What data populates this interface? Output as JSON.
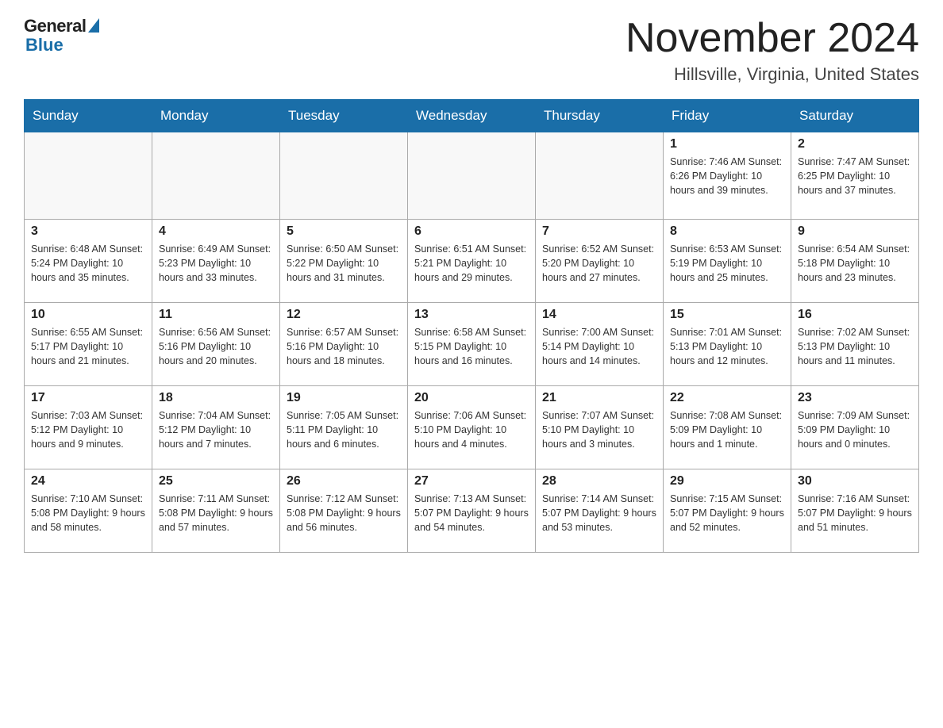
{
  "logo": {
    "general": "General",
    "blue": "Blue"
  },
  "header": {
    "month": "November 2024",
    "location": "Hillsville, Virginia, United States"
  },
  "weekdays": [
    "Sunday",
    "Monday",
    "Tuesday",
    "Wednesday",
    "Thursday",
    "Friday",
    "Saturday"
  ],
  "weeks": [
    [
      {
        "day": "",
        "info": ""
      },
      {
        "day": "",
        "info": ""
      },
      {
        "day": "",
        "info": ""
      },
      {
        "day": "",
        "info": ""
      },
      {
        "day": "",
        "info": ""
      },
      {
        "day": "1",
        "info": "Sunrise: 7:46 AM\nSunset: 6:26 PM\nDaylight: 10 hours and 39 minutes."
      },
      {
        "day": "2",
        "info": "Sunrise: 7:47 AM\nSunset: 6:25 PM\nDaylight: 10 hours and 37 minutes."
      }
    ],
    [
      {
        "day": "3",
        "info": "Sunrise: 6:48 AM\nSunset: 5:24 PM\nDaylight: 10 hours and 35 minutes."
      },
      {
        "day": "4",
        "info": "Sunrise: 6:49 AM\nSunset: 5:23 PM\nDaylight: 10 hours and 33 minutes."
      },
      {
        "day": "5",
        "info": "Sunrise: 6:50 AM\nSunset: 5:22 PM\nDaylight: 10 hours and 31 minutes."
      },
      {
        "day": "6",
        "info": "Sunrise: 6:51 AM\nSunset: 5:21 PM\nDaylight: 10 hours and 29 minutes."
      },
      {
        "day": "7",
        "info": "Sunrise: 6:52 AM\nSunset: 5:20 PM\nDaylight: 10 hours and 27 minutes."
      },
      {
        "day": "8",
        "info": "Sunrise: 6:53 AM\nSunset: 5:19 PM\nDaylight: 10 hours and 25 minutes."
      },
      {
        "day": "9",
        "info": "Sunrise: 6:54 AM\nSunset: 5:18 PM\nDaylight: 10 hours and 23 minutes."
      }
    ],
    [
      {
        "day": "10",
        "info": "Sunrise: 6:55 AM\nSunset: 5:17 PM\nDaylight: 10 hours and 21 minutes."
      },
      {
        "day": "11",
        "info": "Sunrise: 6:56 AM\nSunset: 5:16 PM\nDaylight: 10 hours and 20 minutes."
      },
      {
        "day": "12",
        "info": "Sunrise: 6:57 AM\nSunset: 5:16 PM\nDaylight: 10 hours and 18 minutes."
      },
      {
        "day": "13",
        "info": "Sunrise: 6:58 AM\nSunset: 5:15 PM\nDaylight: 10 hours and 16 minutes."
      },
      {
        "day": "14",
        "info": "Sunrise: 7:00 AM\nSunset: 5:14 PM\nDaylight: 10 hours and 14 minutes."
      },
      {
        "day": "15",
        "info": "Sunrise: 7:01 AM\nSunset: 5:13 PM\nDaylight: 10 hours and 12 minutes."
      },
      {
        "day": "16",
        "info": "Sunrise: 7:02 AM\nSunset: 5:13 PM\nDaylight: 10 hours and 11 minutes."
      }
    ],
    [
      {
        "day": "17",
        "info": "Sunrise: 7:03 AM\nSunset: 5:12 PM\nDaylight: 10 hours and 9 minutes."
      },
      {
        "day": "18",
        "info": "Sunrise: 7:04 AM\nSunset: 5:12 PM\nDaylight: 10 hours and 7 minutes."
      },
      {
        "day": "19",
        "info": "Sunrise: 7:05 AM\nSunset: 5:11 PM\nDaylight: 10 hours and 6 minutes."
      },
      {
        "day": "20",
        "info": "Sunrise: 7:06 AM\nSunset: 5:10 PM\nDaylight: 10 hours and 4 minutes."
      },
      {
        "day": "21",
        "info": "Sunrise: 7:07 AM\nSunset: 5:10 PM\nDaylight: 10 hours and 3 minutes."
      },
      {
        "day": "22",
        "info": "Sunrise: 7:08 AM\nSunset: 5:09 PM\nDaylight: 10 hours and 1 minute."
      },
      {
        "day": "23",
        "info": "Sunrise: 7:09 AM\nSunset: 5:09 PM\nDaylight: 10 hours and 0 minutes."
      }
    ],
    [
      {
        "day": "24",
        "info": "Sunrise: 7:10 AM\nSunset: 5:08 PM\nDaylight: 9 hours and 58 minutes."
      },
      {
        "day": "25",
        "info": "Sunrise: 7:11 AM\nSunset: 5:08 PM\nDaylight: 9 hours and 57 minutes."
      },
      {
        "day": "26",
        "info": "Sunrise: 7:12 AM\nSunset: 5:08 PM\nDaylight: 9 hours and 56 minutes."
      },
      {
        "day": "27",
        "info": "Sunrise: 7:13 AM\nSunset: 5:07 PM\nDaylight: 9 hours and 54 minutes."
      },
      {
        "day": "28",
        "info": "Sunrise: 7:14 AM\nSunset: 5:07 PM\nDaylight: 9 hours and 53 minutes."
      },
      {
        "day": "29",
        "info": "Sunrise: 7:15 AM\nSunset: 5:07 PM\nDaylight: 9 hours and 52 minutes."
      },
      {
        "day": "30",
        "info": "Sunrise: 7:16 AM\nSunset: 5:07 PM\nDaylight: 9 hours and 51 minutes."
      }
    ]
  ]
}
